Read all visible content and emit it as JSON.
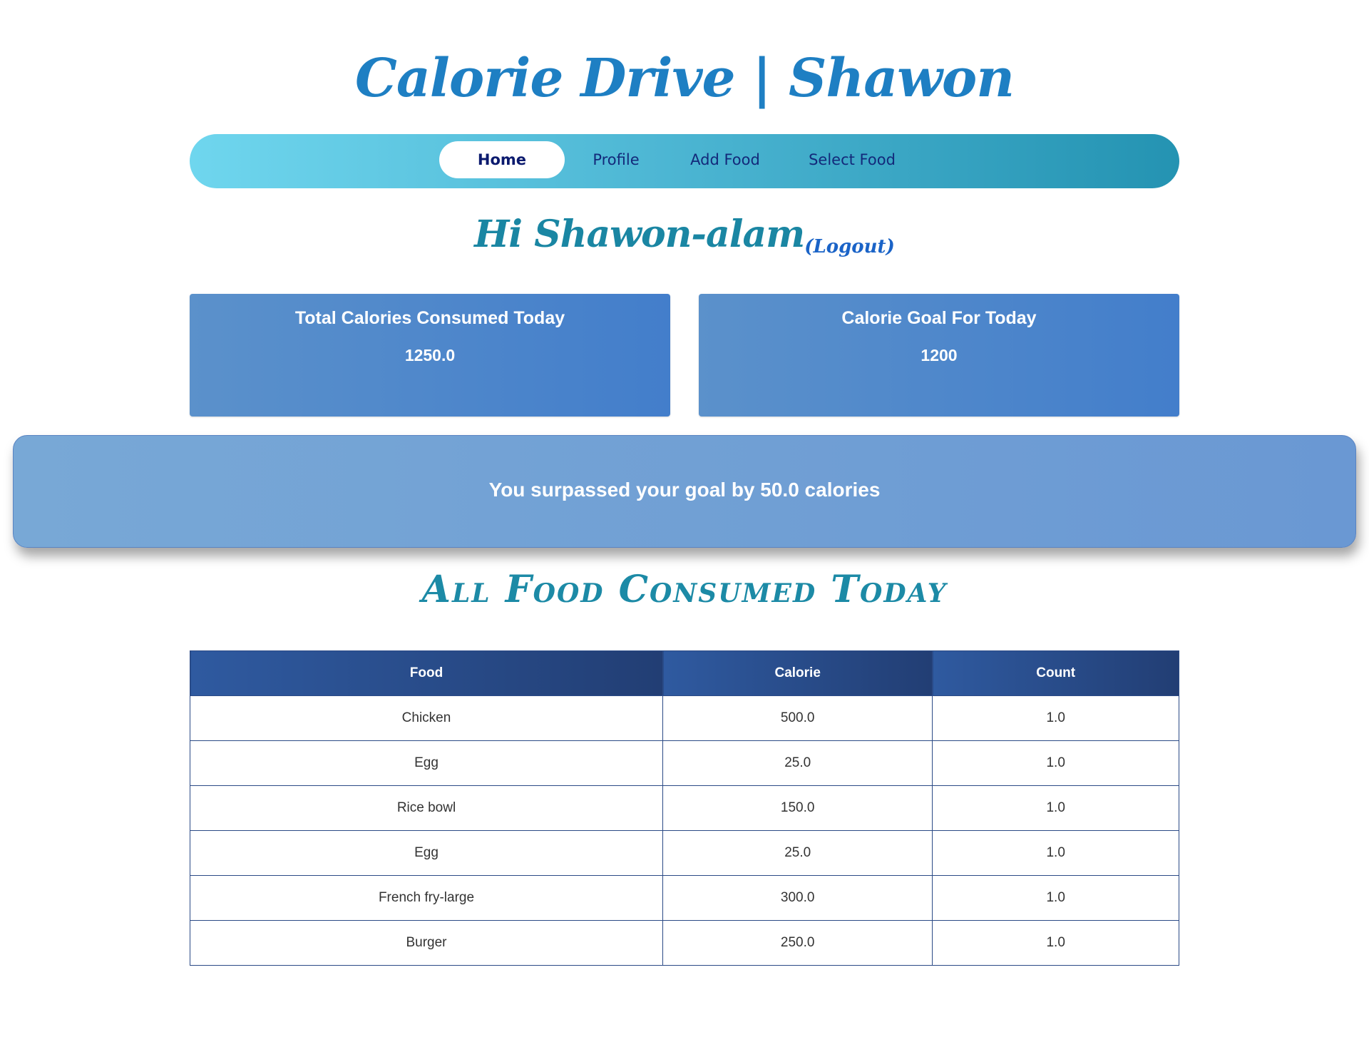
{
  "header": {
    "title": "Calorie Drive | Shawon"
  },
  "nav": {
    "items": [
      {
        "label": "Home",
        "active": true
      },
      {
        "label": "Profile",
        "active": false
      },
      {
        "label": "Add Food",
        "active": false
      },
      {
        "label": "Select Food",
        "active": false
      }
    ]
  },
  "greeting": {
    "text": "Hi Shawon-alam",
    "logout_label": "(Logout)"
  },
  "stats": {
    "consumed": {
      "label": "Total Calories Consumed Today",
      "value": "1250.0"
    },
    "goal": {
      "label": "Calorie Goal For Today",
      "value": "1200"
    }
  },
  "alert": {
    "text": "You surpassed your goal by 50.0 calories"
  },
  "food_section": {
    "title": "All Food Consumed Today",
    "columns": [
      "Food",
      "Calorie",
      "Count"
    ],
    "rows": [
      [
        "Chicken",
        "500.0",
        "1.0"
      ],
      [
        "Egg",
        "25.0",
        "1.0"
      ],
      [
        "Rice bowl",
        "150.0",
        "1.0"
      ],
      [
        "Egg",
        "25.0",
        "1.0"
      ],
      [
        "French fry-large",
        "300.0",
        "1.0"
      ],
      [
        "Burger",
        "250.0",
        "1.0"
      ]
    ]
  },
  "colors": {
    "title": "#1e7fc3",
    "nav_gradient_start": "#6fd6ee",
    "nav_gradient_end": "#2493b2",
    "card": "#4d86cb",
    "alert": "#74a2d5",
    "table_header": "#2a4e8e"
  }
}
